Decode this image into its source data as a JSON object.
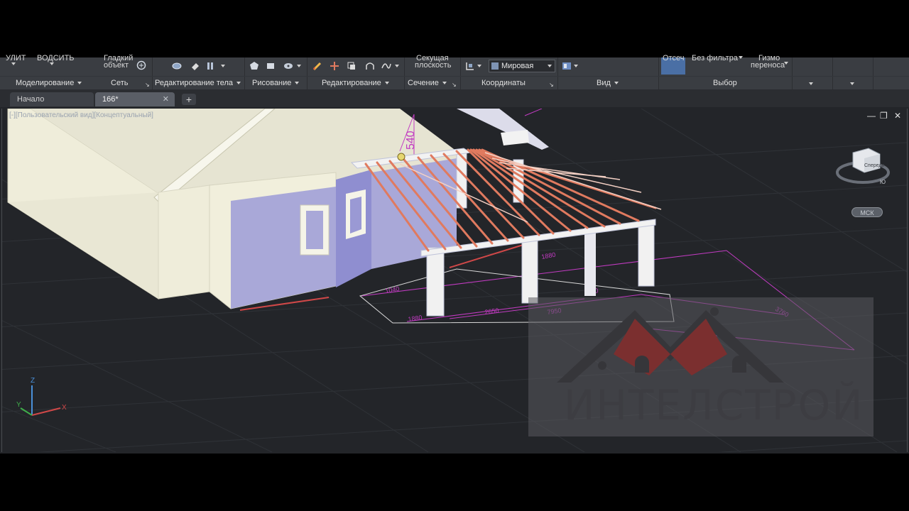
{
  "ribbon": {
    "cropped_top": {
      "left1": "УЛИТ",
      "left2": "ВОДСИТЬ",
      "obj_line1": "Гладкий",
      "obj_line2": "объект",
      "section_line1": "Секущая",
      "section_line2": "плоскость",
      "filter_left": "Отсеч",
      "filter": "Без фильтра",
      "gizmo_line1": "Гизмо",
      "gizmo_line2": "переноса"
    },
    "coord_select": "Мировая",
    "panels": [
      {
        "label": "Моделирование"
      },
      {
        "label": "Сеть"
      },
      {
        "label": "Редактирование тела"
      },
      {
        "label": "Рисование"
      },
      {
        "label": "Редактирование"
      },
      {
        "label": "Сечение"
      },
      {
        "label": "Координаты"
      },
      {
        "label": "Вид"
      },
      {
        "label": "Выбор"
      }
    ]
  },
  "tabs": [
    {
      "label": "Начало",
      "active": false
    },
    {
      "label": "166*",
      "active": true
    }
  ],
  "viewport": {
    "label": "[-][Пользовательский вид][Концептуальный]",
    "ucs_button": "МСК",
    "viewcube_face": "Спереди",
    "viewcube_direction": "Ю",
    "axes": {
      "x": "X",
      "y": "Y",
      "z": "Z"
    },
    "annotations": {
      "height_dim": "540",
      "dims": [
        "1040",
        "2650",
        "1880",
        "2950",
        "7950",
        "1880",
        "3760"
      ]
    }
  },
  "watermark": {
    "text": "ИНТЕЛСТРОЙ"
  },
  "colors": {
    "accent": "#4a6fa5",
    "wall": "#f0eedc",
    "wall_shadow": "#a9a8d8",
    "rafter": "#e07a5f",
    "dimension": "#c23bc2"
  }
}
